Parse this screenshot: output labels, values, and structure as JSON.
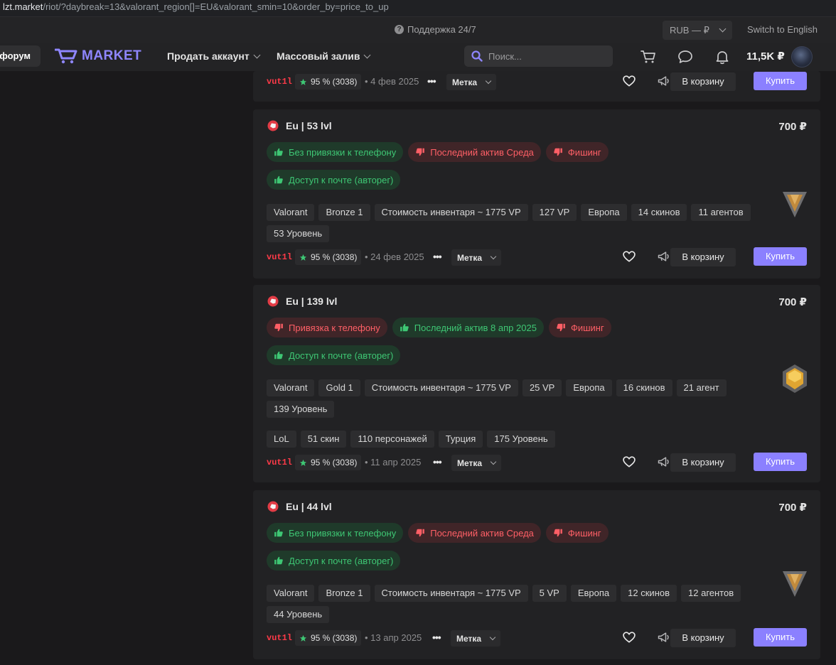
{
  "browser": {
    "host": "lzt.market",
    "path": "/riot/?daybreak=13&valorant_region[]=EU&valorant_smin=10&order_by=price_to_up"
  },
  "topbar": {
    "support": "Поддержка 24/7",
    "currency": "RUB — ₽",
    "language": "Switch to English"
  },
  "header": {
    "forum": "форум",
    "logo": "MARKET",
    "sell_account": "Продать аккаунт",
    "mass_upload": "Массовый залив",
    "search_placeholder": "Поиск...",
    "balance": "11,5K ₽"
  },
  "common": {
    "tag_label": "Метка",
    "cart_label": "В корзину",
    "buy_label": "Купить",
    "seller": "vut1l",
    "rating": "95 % (3038)"
  },
  "colors": {
    "accent": "#8b80ff",
    "good": "#3ec774",
    "bad": "#ff5f66",
    "seller": "#ff3a48"
  },
  "listings": [
    {
      "partial": true,
      "date": "4 фев 2025"
    },
    {
      "title": "Eu | 53 lvl",
      "price": "700 ₽",
      "rank_icon": "bronze-rank-icon",
      "badges": [
        {
          "text": "Без привязки к телефону",
          "type": "good"
        },
        {
          "text": "Последний актив Среда",
          "type": "bad"
        },
        {
          "text": "Фишинг",
          "type": "bad"
        },
        {
          "text": "Доступ к почте (авторег)",
          "type": "good"
        }
      ],
      "chips": [
        "Valorant",
        "Bronze 1",
        "Стоимость инвентаря ~ 1775 VP",
        "127 VP",
        "Европа",
        "14 скинов",
        "11 агентов",
        "53 Уровень"
      ],
      "date": "24 фев 2025"
    },
    {
      "title": "Eu | 139 lvl",
      "price": "700 ₽",
      "rank_icon": "gold-rank-icon",
      "badges": [
        {
          "text": "Привязка к телефону",
          "type": "bad"
        },
        {
          "text": "Последний актив 8 апр 2025",
          "type": "good"
        },
        {
          "text": "Фишинг",
          "type": "bad"
        },
        {
          "text": "Доступ к почте (авторег)",
          "type": "good"
        }
      ],
      "chips": [
        "Valorant",
        "Gold 1",
        "Стоимость инвентаря ~ 1775 VP",
        "25 VP",
        "Европа",
        "16 скинов",
        "21 агент",
        "139 Уровень"
      ],
      "chips2": [
        "LoL",
        "51 скин",
        "110 персонажей",
        "Турция",
        "175 Уровень"
      ],
      "date": "11 апр 2025"
    },
    {
      "title": "Eu | 44 lvl",
      "price": "700 ₽",
      "rank_icon": "bronze-rank-icon",
      "badges": [
        {
          "text": "Без привязки к телефону",
          "type": "good"
        },
        {
          "text": "Последний актив Среда",
          "type": "bad"
        },
        {
          "text": "Фишинг",
          "type": "bad"
        },
        {
          "text": "Доступ к почте (авторег)",
          "type": "good"
        }
      ],
      "chips": [
        "Valorant",
        "Bronze 1",
        "Стоимость инвентаря ~ 1775 VP",
        "5 VP",
        "Европа",
        "12 скинов",
        "12 агентов",
        "44 Уровень"
      ],
      "date": "13 апр 2025"
    }
  ]
}
